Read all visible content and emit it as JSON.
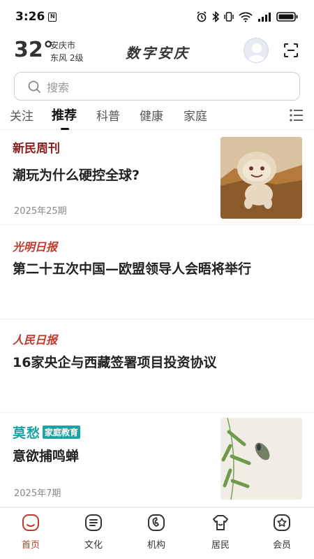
{
  "status_bar": {
    "time": "3:26",
    "battery_icon": "battery-icon",
    "signal_icon": "signal-icon",
    "wifi_icon": "wifi-icon"
  },
  "header": {
    "temperature": "32°",
    "city": "安庆市",
    "wind": "东风  2级",
    "app_title": "数字安庆"
  },
  "search": {
    "placeholder": "搜索"
  },
  "tabs": [
    {
      "label": "关注"
    },
    {
      "label": "推荐"
    },
    {
      "label": "科普"
    },
    {
      "label": "健康"
    },
    {
      "label": "家庭"
    }
  ],
  "active_tab": "推荐",
  "articles": [
    {
      "source": "新民周刊",
      "headline": "潮玩为什么硬控全球?",
      "issue": "2025年25期",
      "has_thumb": true
    },
    {
      "source": "光明日报",
      "headline": "第二十五次中国—欧盟领导人会晤将举行"
    },
    {
      "source": "人民日报",
      "headline": "16家央企与西藏签署项目投资协议"
    },
    {
      "source_main": "莫愁",
      "source_tag": "家庭教育",
      "headline": "意欲捕鸣蝉",
      "issue": "2025年7期",
      "has_thumb": true
    }
  ],
  "bottom_nav": [
    {
      "label": "首页",
      "icon": "home-icon"
    },
    {
      "label": "文化",
      "icon": "culture-icon"
    },
    {
      "label": "机构",
      "icon": "institution-icon"
    },
    {
      "label": "居民",
      "icon": "resident-icon"
    },
    {
      "label": "会员",
      "icon": "member-icon"
    }
  ],
  "colors": {
    "accent": "#c0392b",
    "teal": "#1aa3a3",
    "text": "#222222",
    "muted": "#888888"
  }
}
